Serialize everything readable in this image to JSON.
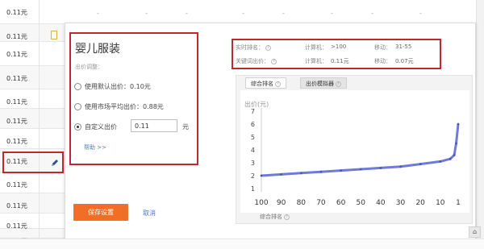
{
  "table": {
    "rows": [
      {
        "price": "0.11元"
      },
      {
        "price": "0.11元"
      },
      {
        "price": "0.11元"
      },
      {
        "price": "0.11元"
      },
      {
        "price": "0.11元"
      },
      {
        "price": "0.11元"
      },
      {
        "price": "0.11元"
      },
      {
        "price": "0.11元"
      },
      {
        "price": "0.11元"
      },
      {
        "price": "0.11元"
      },
      {
        "price": "0.11元"
      },
      {
        "price": "0.11元"
      },
      {
        "price": "0.11元"
      }
    ],
    "dash": "-"
  },
  "popup": {
    "title": "婴儿服装",
    "bid_section_label": "出价调整：",
    "options": [
      {
        "label": "使用默认出价：0.10元",
        "checked": false
      },
      {
        "label": "使用市场平均出价：0.88元",
        "checked": false
      },
      {
        "label": "自定义出价",
        "checked": true
      }
    ],
    "custom_bid_value": "0.11",
    "unit": "元",
    "help_link": "帮助 >>",
    "save_button": "保存设置",
    "cancel_link": "取消"
  },
  "info": {
    "realtime_rank_label": "实时排名：",
    "computer_label": "计算机：",
    "computer_rank": ">100",
    "mobile_label": "移动：",
    "mobile_rank": "31-55",
    "keyword_bid_label": "关键词出价：",
    "computer_bid": "0.11元",
    "mobile_bid": "0.07元"
  },
  "chart_tabs": [
    {
      "label": "综合排名",
      "active": true
    },
    {
      "label": "出价模拟器",
      "active": false
    }
  ],
  "chart_data": {
    "type": "line",
    "ylabel": "出价(元)",
    "xlabel": "综合排名",
    "x_ticks": [
      "100",
      "90",
      "80",
      "70",
      "60",
      "50",
      "40",
      "30",
      "20",
      "10",
      "1"
    ],
    "y_ticks": [
      "1",
      "2",
      "3",
      "4",
      "5",
      "6",
      "7"
    ],
    "ylim": [
      1,
      7
    ],
    "xlim": [
      100,
      1
    ],
    "x": [
      100,
      90,
      80,
      70,
      60,
      50,
      40,
      30,
      20,
      10,
      5,
      3,
      2,
      1
    ],
    "values": [
      2.0,
      2.1,
      2.2,
      2.3,
      2.4,
      2.5,
      2.6,
      2.7,
      2.9,
      3.1,
      3.3,
      3.6,
      4.5,
      6.0
    ],
    "line_color": "#6f7bd6"
  },
  "colors": {
    "accent_orange": "#f26e26",
    "highlight_red": "#c0282e",
    "link_blue": "#4a7ac8"
  },
  "icons": {
    "pencil": "pencil-icon",
    "note": "note-icon",
    "help": "?",
    "corner": "⌂"
  }
}
